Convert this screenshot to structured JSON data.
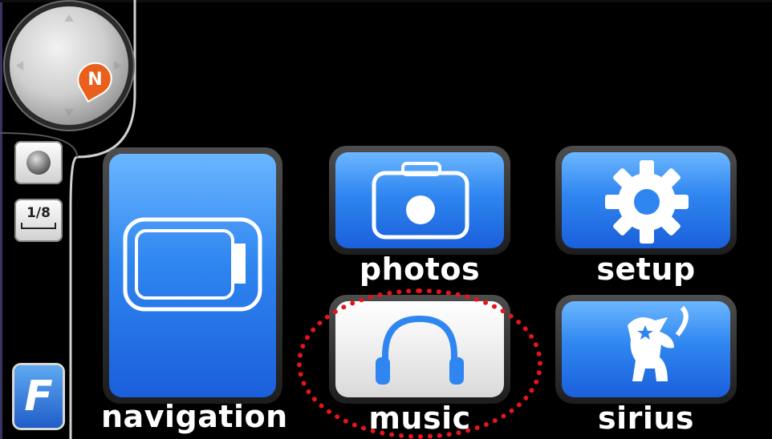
{
  "map_controls": {
    "compass_north": "N",
    "scale": "1/8"
  },
  "brand": {
    "logo_letter": "F"
  },
  "menu": {
    "navigation": "navigation",
    "photos": "photos",
    "setup": "setup",
    "music": "music",
    "sirius": "sirius",
    "selected": "music"
  },
  "colors": {
    "tile_blue": "#2f86f0",
    "highlight_ring": "#e8141b"
  }
}
